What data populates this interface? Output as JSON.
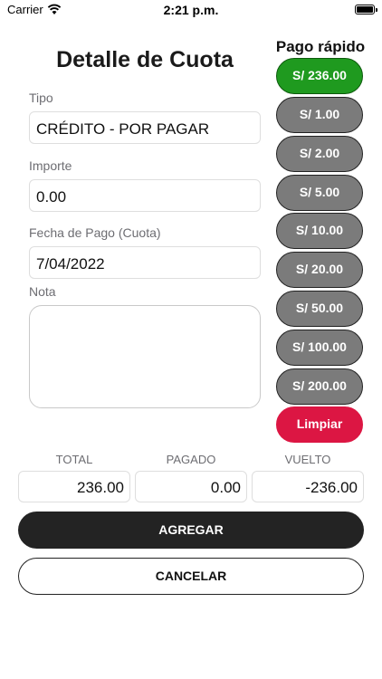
{
  "status_bar": {
    "carrier": "Carrier",
    "time": "2:21 p.m."
  },
  "form": {
    "title": "Detalle de Cuota",
    "tipo_label": "Tipo",
    "tipo_value": "CRÉDITO - POR PAGAR",
    "importe_label": "Importe",
    "importe_value": "0.00",
    "fecha_label": "Fecha de Pago (Cuota)",
    "fecha_value": "7/04/2022",
    "nota_label": "Nota",
    "nota_value": ""
  },
  "quick_pay": {
    "title": "Pago rápido",
    "buttons": [
      "S/ 236.00",
      "S/ 1.00",
      "S/ 2.00",
      "S/ 5.00",
      "S/ 10.00",
      "S/ 20.00",
      "S/ 50.00",
      "S/ 100.00",
      "S/ 200.00"
    ],
    "clear_label": "Limpiar",
    "colors": {
      "highlight": "#1f9a1f",
      "default": "#7b7b7b",
      "clear": "#dc1643"
    }
  },
  "totals": {
    "total_label": "TOTAL",
    "total_value": "236.00",
    "pagado_label": "PAGADO",
    "pagado_value": "0.00",
    "vuelto_label": "VUELTO",
    "vuelto_value": "-236.00"
  },
  "actions": {
    "add_label": "AGREGAR",
    "cancel_label": "CANCELAR"
  }
}
